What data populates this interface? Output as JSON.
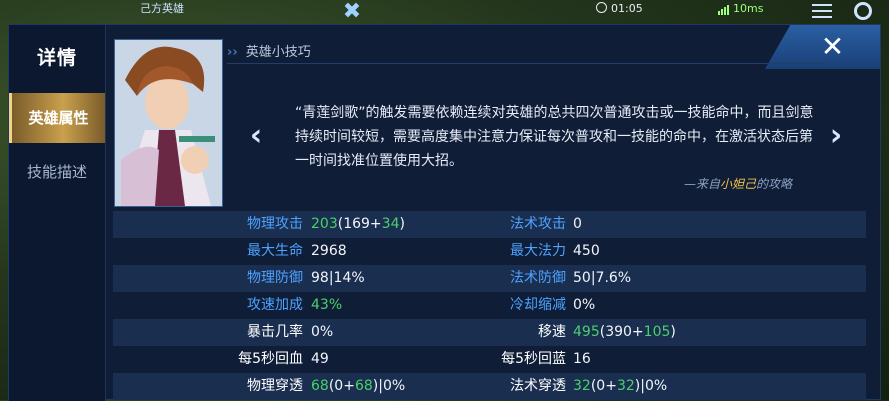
{
  "hud": {
    "ally_team": "己方英雄",
    "timer": "01:05",
    "ping": "10ms"
  },
  "dialog": {
    "title": "详情",
    "tabs": [
      "英雄属性",
      "技能描述"
    ],
    "close_glyph": "✕"
  },
  "tip": {
    "header": "英雄小技巧",
    "text": "“青莲剑歌”的触发需要依赖连续对英雄的总共四次普通攻击或一技能命中，而且剑意持续时间较短，需要高度集中注意力保证每次普攻和一技能的命中，在激活状态后第一时间找准位置使用大招。",
    "source_prefix": "—来自",
    "source_name": "小妲己",
    "source_suffix": "的攻略"
  },
  "stats": [
    {
      "left_label": "物理攻击",
      "left_value": [
        "203",
        "(169+",
        "34",
        ")"
      ],
      "right_label": "法术攻击",
      "right_value": [
        "0"
      ],
      "lblue": true,
      "rblue": true
    },
    {
      "left_label": "最大生命",
      "left_value": [
        "2968"
      ],
      "right_label": "最大法力",
      "right_value": [
        "450"
      ],
      "lblue": true,
      "rblue": true
    },
    {
      "left_label": "物理防御",
      "left_value": [
        "98|14%"
      ],
      "right_label": "法术防御",
      "right_value": [
        "50|7.6%"
      ],
      "lblue": true,
      "rblue": true
    },
    {
      "left_label": "攻速加成",
      "left_value": [
        "43%"
      ],
      "right_label": "冷却缩减",
      "right_value": [
        "0%"
      ],
      "lblue": true,
      "rblue": true,
      "lgreen": true
    },
    {
      "left_label": "暴击几率",
      "left_value": [
        "0%"
      ],
      "right_label": "移速",
      "right_value": [
        "495",
        "(390+",
        "105",
        ")"
      ],
      "lblue": false,
      "rblue": false
    },
    {
      "left_label": "每5秒回血",
      "left_value": [
        "49"
      ],
      "right_label": "每5秒回蓝",
      "right_value": [
        "16"
      ],
      "lblue": false,
      "rblue": false
    },
    {
      "left_label": "物理穿透",
      "left_value": [
        "68",
        "(0+",
        "68",
        ")|0%"
      ],
      "right_label": "法术穿透",
      "right_value": [
        "32",
        "(0+",
        "32",
        ")|0%"
      ],
      "lblue": false,
      "rblue": false
    }
  ],
  "colors": {
    "accent_blue": "#4da2ff",
    "bonus_green": "#49d16b",
    "gold": "#c9a04d"
  }
}
